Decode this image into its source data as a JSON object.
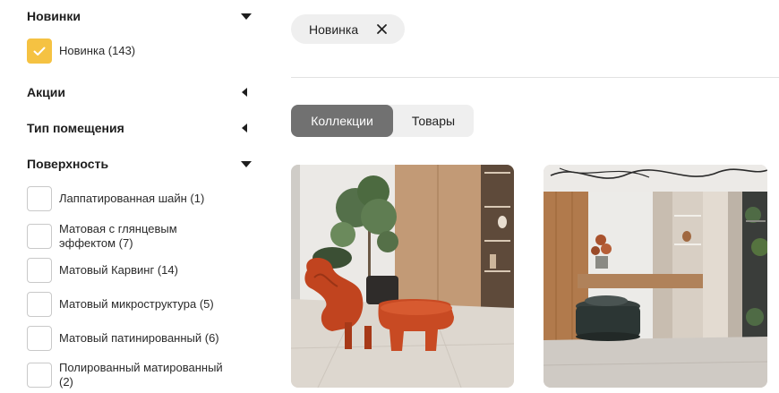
{
  "filters": {
    "novinki": {
      "title": "Новинки",
      "options": [
        {
          "label": "Новинка (143)",
          "checked": true
        }
      ]
    },
    "aktsii": {
      "title": "Акции"
    },
    "tip_pomescheniya": {
      "title": "Тип помещения"
    },
    "poverkhnost": {
      "title": "Поверхность",
      "options": [
        {
          "label": "Лаппатированная шайн (1)",
          "checked": false
        },
        {
          "label_line1": "Матовая с глянцевым",
          "label_line2": "эффектом (7)",
          "checked": false
        },
        {
          "label": "Матовый Карвинг (14)",
          "checked": false
        },
        {
          "label": "Матовый микроструктура (5)",
          "checked": false
        },
        {
          "label": "Матовый патинированный (6)",
          "checked": false
        },
        {
          "label_line1": "Полированный матированный",
          "label_line2": "(2)",
          "checked": false
        }
      ]
    }
  },
  "active_filters": [
    {
      "label": "Новинка",
      "remove_icon": "close-icon"
    }
  ],
  "view_toggle": {
    "options": [
      "Коллекции",
      "Товары"
    ],
    "selected": "Коллекции"
  },
  "colors": {
    "accent": "#f5c242",
    "toggle_active": "#717171",
    "chip_bg": "#efefef"
  },
  "products": [
    {
      "image": "interior-orange-lounge-chair"
    },
    {
      "image": "interior-hallway-dark-ottoman"
    }
  ]
}
